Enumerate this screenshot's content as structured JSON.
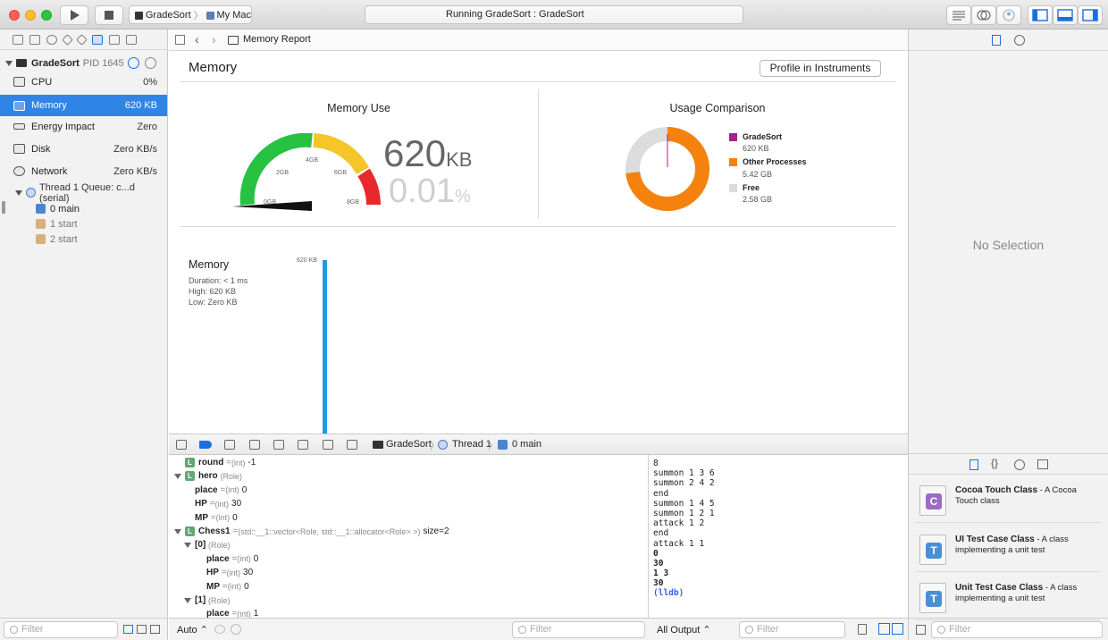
{
  "toolbar": {
    "scheme": "GradeSort",
    "destination": "My Mac",
    "status": "Running GradeSort : GradeSort"
  },
  "navigator": {
    "process": {
      "name": "GradeSort",
      "pid": "PID 1645"
    },
    "gauges": [
      {
        "label": "CPU",
        "value": "0%"
      },
      {
        "label": "Memory",
        "value": "620 KB"
      },
      {
        "label": "Energy Impact",
        "value": "Zero"
      },
      {
        "label": "Disk",
        "value": "Zero KB/s"
      },
      {
        "label": "Network",
        "value": "Zero KB/s"
      }
    ],
    "thread": "Thread 1 Queue: c...d (serial)",
    "frames": [
      "0 main",
      "1 start",
      "2 start"
    ],
    "filter_placeholder": "Filter"
  },
  "jumpbar": {
    "title": "Memory Report"
  },
  "report": {
    "title": "Memory",
    "profile_button": "Profile in Instruments",
    "memory_use": {
      "heading": "Memory Use",
      "value": "620",
      "unit": "KB",
      "percent": "0.01",
      "percent_sign": "%",
      "ticks": [
        "0GB",
        "2GB",
        "4GB",
        "6GB",
        "8GB"
      ]
    },
    "usage_comparison": {
      "heading": "Usage Comparison",
      "items": [
        {
          "name": "GradeSort",
          "value": "620 KB",
          "color": "#a2238f"
        },
        {
          "name": "Other Processes",
          "value": "5.42 GB",
          "color": "#f5820f"
        },
        {
          "name": "Free",
          "value": "2.58 GB",
          "color": "#dcdcdc"
        }
      ]
    },
    "timeline": {
      "title": "Memory",
      "duration": "Duration: < 1 ms",
      "high": "High: 620 KB",
      "low": "Low: Zero KB",
      "peak_label": "620 KB"
    }
  },
  "debugbar": {
    "path": [
      "GradeSort",
      "Thread 1",
      "0 main"
    ]
  },
  "variables": [
    {
      "name": "round",
      "type": "(int)",
      "value": "-1",
      "level": 0,
      "badge": true
    },
    {
      "name": "hero",
      "type": "(Role)",
      "value": "",
      "level": 0,
      "badge": true,
      "expanded": true
    },
    {
      "name": "place",
      "type": "(int)",
      "value": "0",
      "level": 1
    },
    {
      "name": "HP",
      "type": "(int)",
      "value": "30",
      "level": 1
    },
    {
      "name": "MP",
      "type": "(int)",
      "value": "0",
      "level": 1
    },
    {
      "name": "Chess1",
      "type": "(std::__1::vector<Role, std::__1::allocator<Role> >)",
      "value": "size=2",
      "level": 0,
      "badge": true,
      "expanded": true
    },
    {
      "name": "[0]",
      "type": "(Role)",
      "value": "",
      "level": 1,
      "expanded": true
    },
    {
      "name": "place",
      "type": "(int)",
      "value": "0",
      "level": 2
    },
    {
      "name": "HP",
      "type": "(int)",
      "value": "30",
      "level": 2
    },
    {
      "name": "MP",
      "type": "(int)",
      "value": "0",
      "level": 2
    },
    {
      "name": "[1]",
      "type": "(Role)",
      "value": "",
      "level": 1,
      "expanded": true
    },
    {
      "name": "place",
      "type": "(int)",
      "value": "1",
      "level": 2
    }
  ],
  "console": [
    {
      "text": "8",
      "style": ""
    },
    {
      "text": "summon 1 3 6",
      "style": ""
    },
    {
      "text": "summon 2 4 2",
      "style": ""
    },
    {
      "text": "end",
      "style": ""
    },
    {
      "text": "summon 1 4 5",
      "style": ""
    },
    {
      "text": "summon 1 2 1",
      "style": ""
    },
    {
      "text": "attack 1 2",
      "style": ""
    },
    {
      "text": "end",
      "style": ""
    },
    {
      "text": "attack 1 1",
      "style": ""
    },
    {
      "text": "0",
      "style": "b"
    },
    {
      "text": "30",
      "style": "b"
    },
    {
      "text": "1 3",
      "style": "b"
    },
    {
      "text": "30",
      "style": "b"
    },
    {
      "text": "(lldb)",
      "style": "p"
    }
  ],
  "bottombar": {
    "auto": "Auto",
    "filter": "Filter",
    "output": "All Output",
    "filter2": "Filter"
  },
  "inspector": {
    "no_selection": "No Selection",
    "library": [
      {
        "title": "Cocoa Touch Class",
        "desc": "A Cocoa Touch class",
        "letter": "C",
        "color": "#9b6cc2"
      },
      {
        "title": "UI Test Case Class",
        "desc": "A class implementing a unit test",
        "letter": "T",
        "color": "#4b8fd6"
      },
      {
        "title": "Unit Test Case Class",
        "desc": "A class implementing a unit test",
        "letter": "T",
        "color": "#4b8fd6"
      }
    ],
    "filter": "Filter"
  }
}
